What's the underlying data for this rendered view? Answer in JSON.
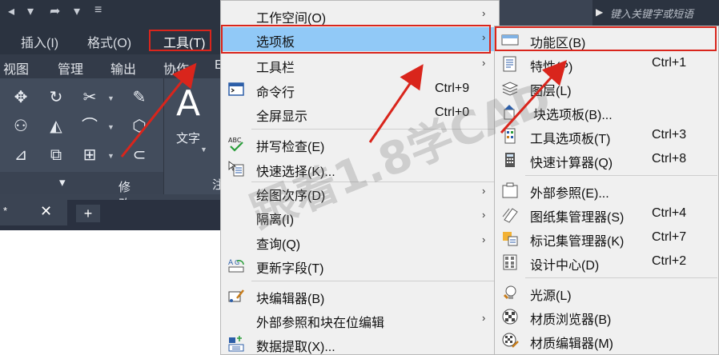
{
  "titlebar": {
    "search_placeholder": "键入关键字或短语"
  },
  "menubar": {
    "items": [
      {
        "label": "插入(I)"
      },
      {
        "label": "格式(O)"
      },
      {
        "label": "工具(T)"
      }
    ]
  },
  "ribbon": {
    "tabs": [
      {
        "label": "视图"
      },
      {
        "label": "管理"
      },
      {
        "label": "输出"
      },
      {
        "label": "协作"
      },
      {
        "label": "E"
      }
    ],
    "panel_title": "修改",
    "text_tool_glyph": "A",
    "text_tool_label": "文字",
    "partial_panel_label": "注"
  },
  "tabs": {
    "doc_marker": "*",
    "close_glyph": "✕",
    "add_glyph": "+"
  },
  "tools_menu": {
    "items": [
      {
        "label": "工作空间(O)",
        "shortcut": "",
        "submenu": "›"
      },
      {
        "label": "选项板",
        "shortcut": "",
        "submenu": "›"
      },
      {
        "label": "工具栏",
        "shortcut": "",
        "submenu": "›"
      },
      {
        "label": "命令行",
        "shortcut": "Ctrl+9",
        "submenu": ""
      },
      {
        "label": "全屏显示",
        "shortcut": "Ctrl+0",
        "submenu": ""
      },
      {
        "label": "拼写检查(E)",
        "shortcut": "",
        "submenu": ""
      },
      {
        "label": "快速选择(K)...",
        "shortcut": "",
        "submenu": ""
      },
      {
        "label": "绘图次序(D)",
        "shortcut": "",
        "submenu": "›"
      },
      {
        "label": "隔离(I)",
        "shortcut": "",
        "submenu": "›"
      },
      {
        "label": "查询(Q)",
        "shortcut": "",
        "submenu": "›"
      },
      {
        "label": "更新字段(T)",
        "shortcut": "",
        "submenu": ""
      },
      {
        "label": "块编辑器(B)",
        "shortcut": "",
        "submenu": ""
      },
      {
        "label": "外部参照和块在位编辑",
        "shortcut": "",
        "submenu": "›"
      },
      {
        "label": "数据提取(X)...",
        "shortcut": "",
        "submenu": ""
      }
    ]
  },
  "palettes_menu": {
    "items": [
      {
        "label": "功能区(B)",
        "shortcut": ""
      },
      {
        "label": "特性(P)",
        "shortcut": "Ctrl+1"
      },
      {
        "label": "图层(L)",
        "shortcut": ""
      },
      {
        "label": "块选项板(B)...",
        "shortcut": ""
      },
      {
        "label": "工具选项板(T)",
        "shortcut": "Ctrl+3"
      },
      {
        "label": "快速计算器(Q)",
        "shortcut": "Ctrl+8"
      },
      {
        "label": "外部参照(E)...",
        "shortcut": ""
      },
      {
        "label": "图纸集管理器(S)",
        "shortcut": "Ctrl+4"
      },
      {
        "label": "标记集管理器(K)",
        "shortcut": "Ctrl+7"
      },
      {
        "label": "设计中心(D)",
        "shortcut": "Ctrl+2"
      },
      {
        "label": "光源(L)",
        "shortcut": ""
      },
      {
        "label": "材质浏览器(B)",
        "shortcut": ""
      },
      {
        "label": "材质编辑器(M)",
        "shortcut": ""
      }
    ]
  },
  "watermark": "跟着1.8学CAD",
  "colors": {
    "highlight": "#91c9f7",
    "annotation_red": "#d9251c",
    "menu_bg": "#f0f0f0",
    "cad_dark": "#3b4453"
  }
}
